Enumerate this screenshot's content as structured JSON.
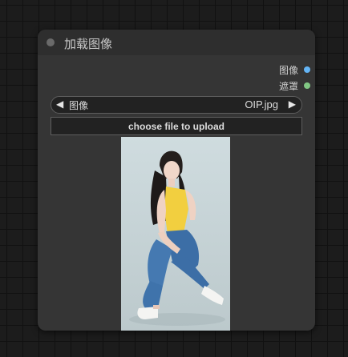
{
  "node": {
    "title": "加载图像",
    "outputs": [
      {
        "label": "图像",
        "color": "#64b5f6"
      },
      {
        "label": "遮罩",
        "color": "#81c784"
      }
    ],
    "image_widget": {
      "name": "图像",
      "value": "OIP.jpg"
    },
    "upload_label": "choose file to upload",
    "icons": {
      "prev": "left-arrow-icon",
      "next": "right-arrow-icon",
      "collapse": "collapse-dot-icon"
    }
  },
  "colors": {
    "canvas": "#1c1c1c",
    "node_body": "#353535",
    "node_header": "#2e2e2e",
    "image_out": "#64b5f6",
    "mask_out": "#81c784"
  }
}
